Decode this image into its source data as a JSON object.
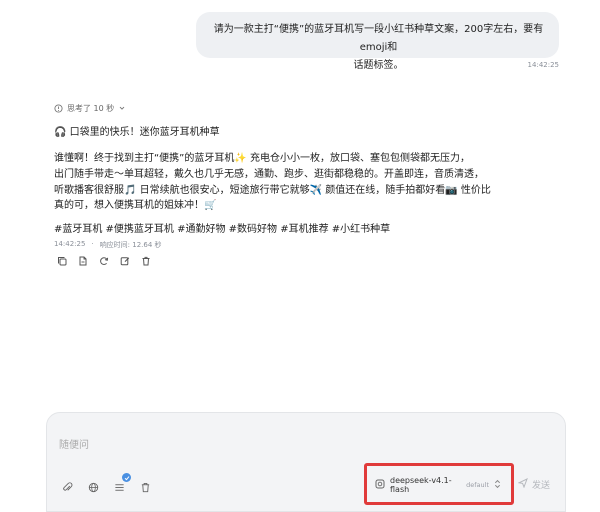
{
  "user_message": {
    "line1": "请为一款主打“便携”的蓝牙耳机写一段小红书种草文案，200字左右，要有emoji和",
    "line2": "话题标签。",
    "time": "14:42:25"
  },
  "thinking": {
    "label": "思考了 10 秒"
  },
  "answer": {
    "title": "🎧 口袋里的快乐！迷你蓝牙耳机种草",
    "lines": [
      "谁懂啊！终于找到主打“便携”的蓝牙耳机✨ 充电仓小小一枚，放口袋、塞包包侧袋都无压力，",
      "出门随手带走～单耳超轻，戴久也几乎无感，通勤、跑步、逛街都稳稳的。开盖即连，音质清透，",
      "听歌播客很舒服🎵 日常续航也很安心，短途旅行带它就够✈️ 颜值还在线，随手拍都好看📷 性价比",
      "真的可，想入便携耳机的姐妹冲！🛒"
    ],
    "hashtags": "#蓝牙耳机 #便携蓝牙耳机 #通勤好物 #数码好物 #耳机推荐 #小红书种草"
  },
  "meta": {
    "time": "14:42:25",
    "sep": "·",
    "response_time": "响应时间: 12.64 秒"
  },
  "actions": [
    {
      "name": "copy-icon"
    },
    {
      "name": "export-icon"
    },
    {
      "name": "regenerate-icon"
    },
    {
      "name": "edit-icon"
    },
    {
      "name": "delete-icon"
    }
  ],
  "composer": {
    "placeholder": "随便问",
    "tool_badge_count": "4",
    "model_name": "deepseek-v4.1-flash",
    "model_tag": "default",
    "send_label": "发送"
  },
  "colors": {
    "highlight_outline": "#e03a3a",
    "badge": "#4a90e2"
  }
}
